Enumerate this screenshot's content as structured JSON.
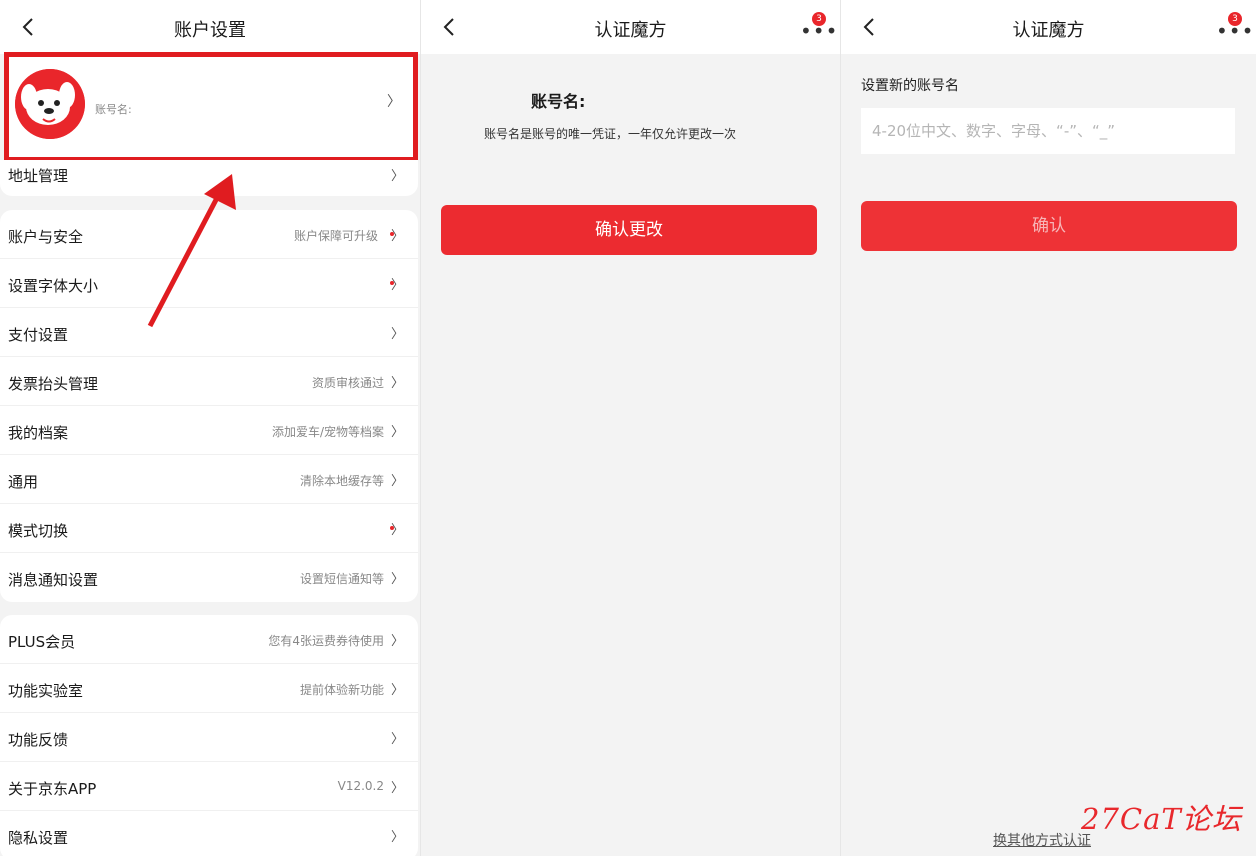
{
  "panel1": {
    "title": "账户设置",
    "profile": {
      "label": "账号名:"
    },
    "address": {
      "label": "地址管理"
    },
    "group1": [
      {
        "label": "账户与安全",
        "value": "账户保障可升级",
        "dot": true
      },
      {
        "label": "设置字体大小",
        "value": "",
        "dot": true
      },
      {
        "label": "支付设置",
        "value": "",
        "dot": false
      },
      {
        "label": "发票抬头管理",
        "value": "资质审核通过",
        "dot": false
      },
      {
        "label": "我的档案",
        "value": "添加爱车/宠物等档案",
        "dot": false
      },
      {
        "label": "通用",
        "value": "清除本地缓存等",
        "dot": false
      },
      {
        "label": "模式切换",
        "value": "",
        "dot": true
      },
      {
        "label": "消息通知设置",
        "value": "设置短信通知等",
        "dot": false
      }
    ],
    "group2": [
      {
        "label": "PLUS会员",
        "value": "您有4张运费券待使用",
        "dot": false
      },
      {
        "label": "功能实验室",
        "value": "提前体验新功能",
        "dot": false
      },
      {
        "label": "功能反馈",
        "value": "",
        "dot": false
      },
      {
        "label": "关于京东APP",
        "value": "V12.0.2",
        "dot": false
      },
      {
        "label": "隐私设置",
        "value": "",
        "dot": false
      }
    ],
    "chevron": "〉",
    "accent_color": "#e01c20"
  },
  "panel2": {
    "title": "认证魔方",
    "badge": "3",
    "heading": "账号名:",
    "description": "账号名是账号的唯一凭证，一年仅允许更改一次",
    "confirm_button": "确认更改"
  },
  "panel3": {
    "title": "认证魔方",
    "badge": "3",
    "field_label": "设置新的账号名",
    "input_placeholder": "4-20位中文、数字、字母、“-”、“_”",
    "input_value": "",
    "confirm_button": "确认",
    "alt_link": "换其他方式认证",
    "watermark": "27CaT论坛"
  },
  "colors": {
    "brand_red": "#ec2b30",
    "bg": "#f3f3f3"
  }
}
